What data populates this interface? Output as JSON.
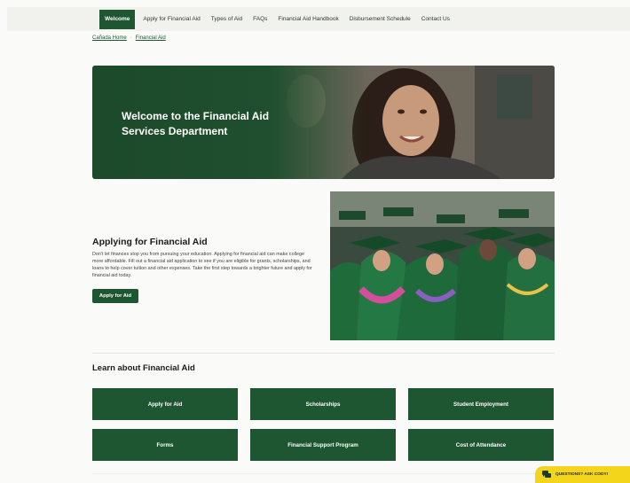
{
  "nav": {
    "items": [
      {
        "label": "Welcome",
        "active": true
      },
      {
        "label": "Apply for Financial Aid"
      },
      {
        "label": "Types of Aid"
      },
      {
        "label": "FAQs"
      },
      {
        "label": "Financial Aid Handbook"
      },
      {
        "label": "Disbursement Schedule"
      },
      {
        "label": "Contact Us"
      }
    ]
  },
  "breadcrumb": {
    "home": "Cañada Home",
    "current": "Financial Aid"
  },
  "hero": {
    "title": "Welcome to the Financial Aid Services Department"
  },
  "apply": {
    "title": "Applying for Financial Aid",
    "text": "Don't let finances stop you from pursuing your education. Applying for financial aid can make college more affordable. Fill out a financial aid application to see if you are eligible for grants, scholarships, and loans to help cover tuition and other expenses. Take the first step towards a brighter future and apply for financial aid today.",
    "button": "Apply for Aid"
  },
  "learn": {
    "title": "Learn about Financial Aid",
    "tiles": [
      "Apply for Aid",
      "Scholarships",
      "Student Employment",
      "Forms",
      "Financial Support Program",
      "Cost of Attendance"
    ]
  },
  "chat": {
    "label": "QUESTIONS? ASK CODY!",
    "icon": "chat-bubble-icon"
  },
  "colors": {
    "brand_green": "#1e5631",
    "nav_bg": "#f1f1ee",
    "chat_yellow": "#f3d51c"
  }
}
